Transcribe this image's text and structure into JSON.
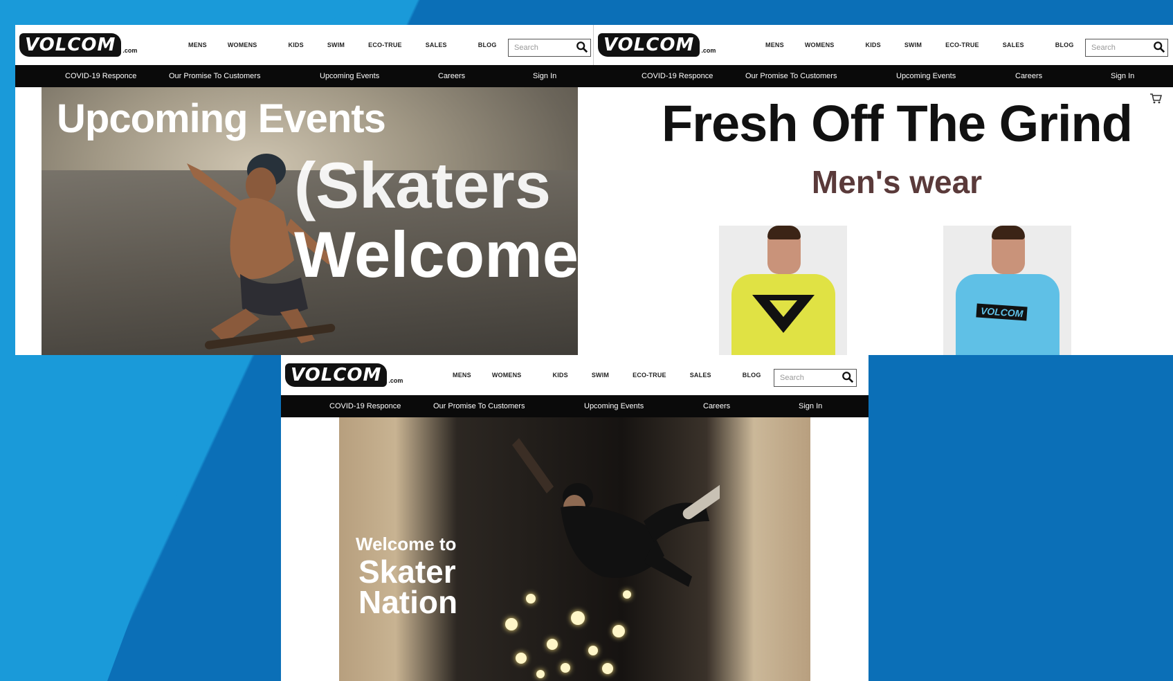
{
  "site": {
    "logo_text": "VOLCOM",
    "logo_domain": ".com",
    "nav": [
      "MENS",
      "WOMENS",
      "KIDS",
      "SWIM",
      "ECO-TRUE",
      "SALES",
      "BLOG"
    ],
    "search_placeholder": "Search",
    "subnav": [
      "COVID-19 Responce",
      "Our Promise To Customers",
      "Upcoming Events",
      "Careers",
      "Sign In"
    ]
  },
  "panel1": {
    "title_line1": "Upcoming Events",
    "title_line2": "(Skaters",
    "title_line3": "Welcome)"
  },
  "panel2": {
    "title": "Fresh Off The Grind",
    "subtitle": "Men's wear",
    "shirt1_logo": "V",
    "shirt2_logo": "VOLCOM",
    "colors": {
      "shirt1": "#e0e244",
      "shirt2": "#5fc0e6",
      "subtitle": "#5a3a3a"
    }
  },
  "panel3": {
    "line1": "Welcome to",
    "line2": "Skater",
    "line3": "Nation"
  },
  "colors": {
    "bg_light": "#1a9ad9",
    "bg_dark": "#0b6fb7",
    "subbar": "#0a0a0a"
  },
  "icons": [
    "search-icon",
    "cart-icon"
  ]
}
